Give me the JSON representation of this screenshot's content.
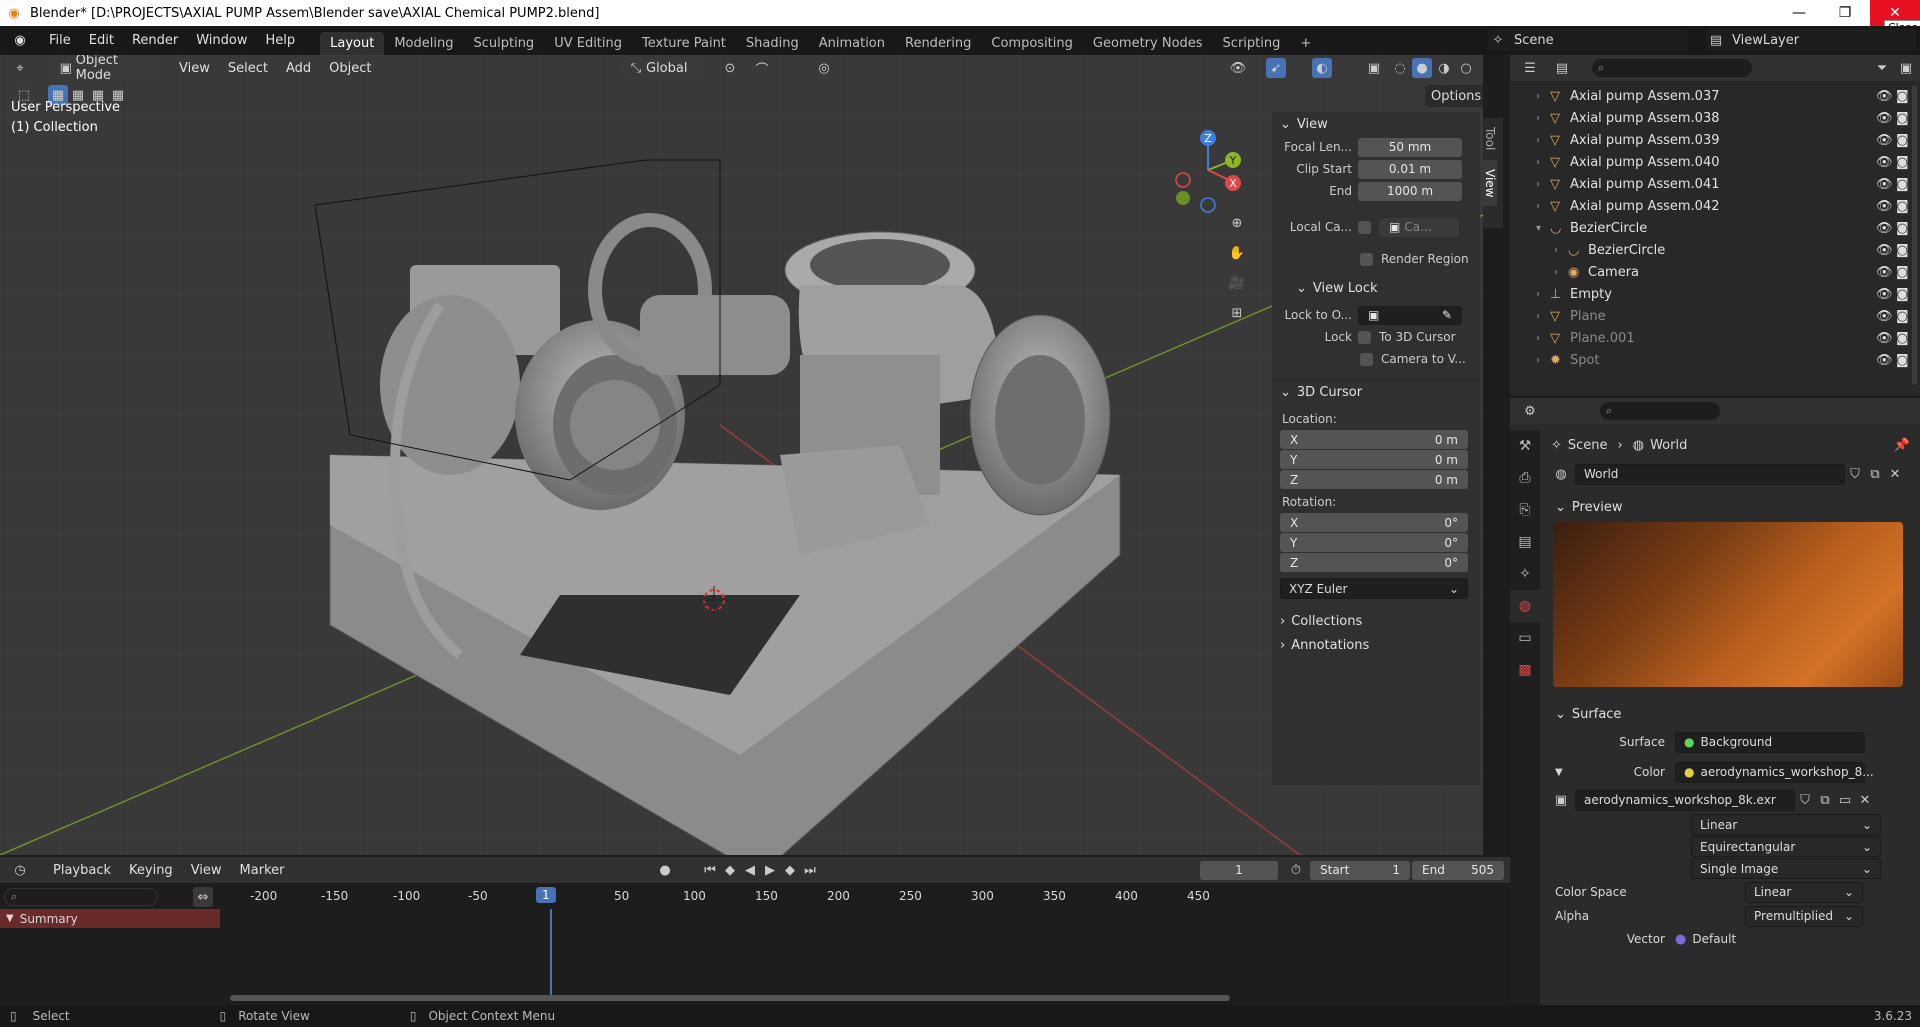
{
  "window": {
    "title": "Blender* [D:\\PROJECTS\\AXIAL PUMP Assem\\Blender save\\AXIAL Chemical PUMP2.blend]",
    "close_tooltip": "Close"
  },
  "menus": [
    "File",
    "Edit",
    "Render",
    "Window",
    "Help"
  ],
  "workspaces": [
    "Layout",
    "Modeling",
    "Sculpting",
    "UV Editing",
    "Texture Paint",
    "Shading",
    "Animation",
    "Rendering",
    "Compositing",
    "Geometry Nodes",
    "Scripting"
  ],
  "active_workspace": "Layout",
  "scene": "Scene",
  "view_layer": "ViewLayer",
  "viewport": {
    "mode": "Object Mode",
    "menu": [
      "View",
      "Select",
      "Add",
      "Object"
    ],
    "transform_orientation": "Global",
    "options_label": "Options",
    "perspective_label": "User Perspective",
    "collection_label": "(1) Collection",
    "gizmo_axes": [
      "Z",
      "Y",
      "X"
    ]
  },
  "npanel": {
    "tabs": [
      "Tool",
      "View"
    ],
    "view": {
      "title": "View",
      "focal_label": "Focal Len...",
      "focal_value": "50 mm",
      "clip_start_label": "Clip Start",
      "clip_start_value": "0.01 m",
      "end_label": "End",
      "end_value": "1000 m",
      "local_camera_label": "Local Ca...",
      "local_camera_placeholder": "Ca...",
      "render_region": "Render Region"
    },
    "view_lock": {
      "title": "View Lock",
      "lock_to_label": "Lock to O...",
      "lock_label": "Lock",
      "to_3d_cursor": "To 3D Cursor",
      "camera_to_view": "Camera to V..."
    },
    "cursor": {
      "title": "3D Cursor",
      "location_label": "Location:",
      "loc": [
        {
          "axis": "X",
          "value": "0 m"
        },
        {
          "axis": "Y",
          "value": "0 m"
        },
        {
          "axis": "Z",
          "value": "0 m"
        }
      ],
      "rotation_label": "Rotation:",
      "rot": [
        {
          "axis": "X",
          "value": "0°"
        },
        {
          "axis": "Y",
          "value": "0°"
        },
        {
          "axis": "Z",
          "value": "0°"
        }
      ],
      "rotation_mode": "XYZ Euler"
    },
    "collections": "Collections",
    "annotations": "Annotations"
  },
  "outliner": {
    "rows": [
      {
        "label": "Axial pump Assem.037",
        "indent": 0
      },
      {
        "label": "Axial pump Assem.038",
        "indent": 0
      },
      {
        "label": "Axial pump Assem.039",
        "indent": 0
      },
      {
        "label": "Axial pump Assem.040",
        "indent": 0
      },
      {
        "label": "Axial pump Assem.041",
        "indent": 0
      },
      {
        "label": "Axial pump Assem.042",
        "indent": 0
      },
      {
        "label": "BezierCircle",
        "indent": 0
      },
      {
        "label": "BezierCircle",
        "indent": 1
      },
      {
        "label": "Camera",
        "indent": 1
      },
      {
        "label": "Empty",
        "indent": 0
      },
      {
        "label": "Plane",
        "indent": 0
      },
      {
        "label": "Plane.001",
        "indent": 0
      },
      {
        "label": "Spot",
        "indent": 0
      }
    ]
  },
  "properties": {
    "breadcrumb": [
      "Scene",
      "World"
    ],
    "world_name": "World",
    "preview_label": "Preview",
    "surface_section": "Surface",
    "surface_label": "Surface",
    "surface_value": "Background",
    "color_label": "Color",
    "color_value": "aerodynamics_workshop_8...",
    "image_name": "aerodynamics_workshop_8k.exr",
    "interpolation": "Linear",
    "projection": "Equirectangular",
    "source": "Single Image",
    "color_space_label": "Color Space",
    "color_space": "Linear",
    "alpha_label": "Alpha",
    "alpha_value": "Premultiplied",
    "vector_label": "Vector",
    "vector_value": "Default"
  },
  "timeline": {
    "menus": [
      "Playback",
      "Keying",
      "View",
      "Marker"
    ],
    "current_frame": "1",
    "start_label": "Start",
    "start_value": "1",
    "end_label": "End",
    "end_value": "505",
    "ticks": [
      "-200",
      "-150",
      "-100",
      "-50",
      "1",
      "50",
      "100",
      "150",
      "200",
      "250",
      "300",
      "350",
      "400",
      "450"
    ],
    "summary": "Summary"
  },
  "statusbar": {
    "select": "Select",
    "rotate": "Rotate View",
    "context": "Object Context Menu",
    "version": "3.6.23"
  },
  "colors": {
    "accent": "#4772b3",
    "mesh_icon": "#e7a85b",
    "summary": "#6b2a2a"
  }
}
